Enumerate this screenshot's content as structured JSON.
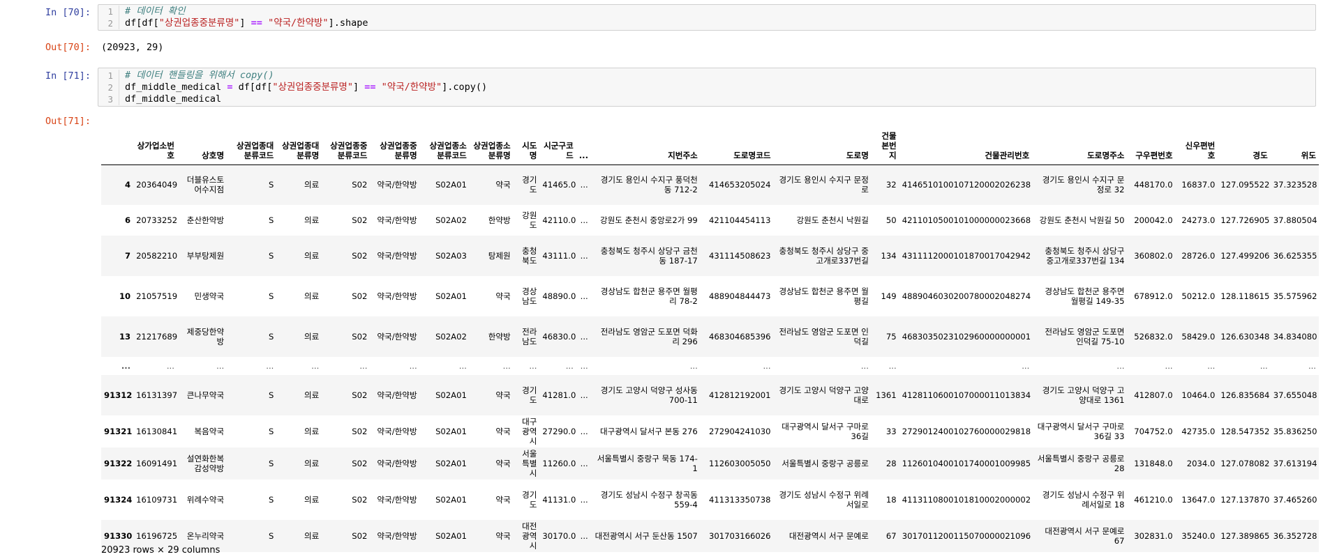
{
  "cell70": {
    "in_prompt": "In [70]:",
    "lines": [
      {
        "n": "1",
        "text": "# 데이터 확인"
      },
      {
        "n": "2",
        "pre": "df[df[",
        "str": "\"상권업종중분류명\"",
        "mid": "] ",
        "op": "==",
        "sp": " ",
        "str2": "\"약국/한약방\"",
        "post": "].shape"
      }
    ],
    "out_prompt": "Out[70]:",
    "output": "(20923, 29)"
  },
  "cell71": {
    "in_prompt": "In [71]:",
    "lines": [
      {
        "n": "1",
        "text": "# 데이터 핸들링을 위해서 copy()"
      },
      {
        "n": "2",
        "pre": "df_middle_medical ",
        "op0": "=",
        "pre2": " df[df[",
        "str": "\"상권업종중분류명\"",
        "mid": "] ",
        "op": "==",
        "sp": " ",
        "str2": "\"약국/한약방\"",
        "post": "].copy()"
      },
      {
        "n": "3",
        "text": "df_middle_medical"
      }
    ],
    "out_prompt": "Out[71]:"
  },
  "dataframe": {
    "columns": [
      "상가업소번호",
      "상호명",
      "상권업종대분류코드",
      "상권업종대분류명",
      "상권업종중분류코드",
      "상권업종중분류명",
      "상권업종소분류코드",
      "상권업종소분류명",
      "시도명",
      "시군구코드",
      "...",
      "지번주소",
      "도로명코드",
      "도로명",
      "건물본번지",
      "건물관리번호",
      "도로명주소",
      "구우편번호",
      "신우편번호",
      "경도",
      "위도"
    ],
    "rows": [
      [
        "4",
        "20364049",
        "더블유스토어수지점",
        "S",
        "의료",
        "S02",
        "약국/한약방",
        "S02A01",
        "약국",
        "경기도",
        "41465.0",
        "...",
        "경기도 용인시 수지구 풍덕천동 712-2",
        "414653205024",
        "경기도 용인시 수지구 문정로",
        "32",
        "4146510100107120002026238",
        "경기도 용인시 수지구 문정로 32",
        "448170.0",
        "16837.0",
        "127.095522",
        "37.323528"
      ],
      [
        "6",
        "20733252",
        "춘산한약방",
        "S",
        "의료",
        "S02",
        "약국/한약방",
        "S02A02",
        "한약방",
        "강원도",
        "42110.0",
        "...",
        "강원도 춘천시 중앙로2가 99",
        "421104454113",
        "강원도 춘천시 낙원길",
        "50",
        "4211010500101000000023668",
        "강원도 춘천시 낙원길 50",
        "200042.0",
        "24273.0",
        "127.726905",
        "37.880504"
      ],
      [
        "7",
        "20582210",
        "부부탕제원",
        "S",
        "의료",
        "S02",
        "약국/한약방",
        "S02A03",
        "탕제원",
        "충청북도",
        "43111.0",
        "...",
        "충청북도 청주시 상당구 금천동 187-17",
        "431114508623",
        "충청북도 청주시 상당구 중고개로337번길",
        "134",
        "4311112000101870017042942",
        "충청북도 청주시 상당구 중고개로337번길 134",
        "360802.0",
        "28726.0",
        "127.499206",
        "36.625355"
      ],
      [
        "10",
        "21057519",
        "민생약국",
        "S",
        "의료",
        "S02",
        "약국/한약방",
        "S02A01",
        "약국",
        "경상남도",
        "48890.0",
        "...",
        "경상남도 합천군 용주면 월평리 78-2",
        "488904844473",
        "경상남도 합천군 용주면 월평길",
        "149",
        "4889046030200780002048274",
        "경상남도 합천군 용주면 월평길 149-35",
        "678912.0",
        "50212.0",
        "128.118615",
        "35.575962"
      ],
      [
        "13",
        "21217689",
        "제중당한약방",
        "S",
        "의료",
        "S02",
        "약국/한약방",
        "S02A02",
        "한약방",
        "전라남도",
        "46830.0",
        "...",
        "전라남도 영암군 도포면 덕화리 296",
        "468304685396",
        "전라남도 영암군 도포면 인덕길",
        "75",
        "4683035023102960000000001",
        "전라남도 영암군 도포면 인덕길 75-10",
        "526832.0",
        "58429.0",
        "126.630348",
        "34.834080"
      ],
      [
        "...",
        "...",
        "...",
        "...",
        "...",
        "...",
        "...",
        "...",
        "...",
        "...",
        "...",
        "...",
        "...",
        "...",
        "...",
        "...",
        "...",
        "...",
        "...",
        "...",
        "...",
        "..."
      ],
      [
        "91312",
        "16131397",
        "큰나무약국",
        "S",
        "의료",
        "S02",
        "약국/한약방",
        "S02A01",
        "약국",
        "경기도",
        "41281.0",
        "...",
        "경기도 고양시 덕양구 성사동 700-11",
        "412812192001",
        "경기도 고양시 덕양구 고양대로",
        "1361",
        "4128110600107000011013834",
        "경기도 고양시 덕양구 고양대로 1361",
        "412807.0",
        "10464.0",
        "126.835684",
        "37.655048"
      ],
      [
        "91321",
        "16130841",
        "복음약국",
        "S",
        "의료",
        "S02",
        "약국/한약방",
        "S02A01",
        "약국",
        "대구광역시",
        "27290.0",
        "...",
        "대구광역시 달서구 본동 276",
        "272904241030",
        "대구광역시 달서구 구마로36길",
        "33",
        "2729012400102760000029818",
        "대구광역시 달서구 구마로36길 33",
        "704752.0",
        "42735.0",
        "128.547352",
        "35.836250"
      ],
      [
        "91322",
        "16091491",
        "설연화한복감성약방",
        "S",
        "의료",
        "S02",
        "약국/한약방",
        "S02A01",
        "약국",
        "서울특별시",
        "11260.0",
        "...",
        "서울특별시 중랑구 묵동 174-1",
        "112603005050",
        "서울특별시 중랑구 공릉로",
        "28",
        "1126010400101740001009985",
        "서울특별시 중랑구 공릉로 28",
        "131848.0",
        "2034.0",
        "127.078082",
        "37.613194"
      ],
      [
        "91324",
        "16109731",
        "위례수약국",
        "S",
        "의료",
        "S02",
        "약국/한약방",
        "S02A01",
        "약국",
        "경기도",
        "41131.0",
        "...",
        "경기도 성남시 수정구 창곡동 559-4",
        "411313350738",
        "경기도 성남시 수정구 위례서일로",
        "18",
        "4113110800101810002000002",
        "경기도 성남시 수정구 위례서일로 18",
        "461210.0",
        "13647.0",
        "127.137870",
        "37.465260"
      ],
      [
        "91330",
        "16196725",
        "온누리약국",
        "S",
        "의료",
        "S02",
        "약국/한약방",
        "S02A01",
        "약국",
        "대전광역시",
        "30170.0",
        "...",
        "대전광역시 서구 둔산동 1507",
        "301703166026",
        "대전광역시 서구 문예로",
        "67",
        "3017011200115070000021096",
        "대전광역시 서구 문예로 67",
        "302831.0",
        "35240.0",
        "127.389865",
        "36.352728"
      ]
    ],
    "shape_note": "20923 rows × 29 columns"
  }
}
